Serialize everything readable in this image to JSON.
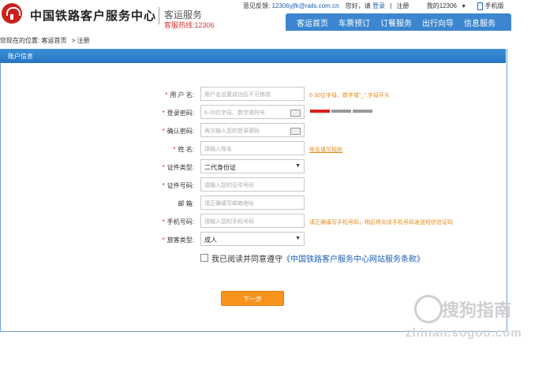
{
  "header": {
    "brand": "中国铁路客户服务中心",
    "brand_sub": "客运服务",
    "hotline": "客服热线:12306",
    "feedback_label": "意见反馈:",
    "feedback_email": "12306yjfk@rails.com.cn",
    "greeting": "您好，请",
    "login": "登录",
    "sep": "|",
    "register": "注册",
    "my12306": "我的12306",
    "mobile": "手机版"
  },
  "nav": [
    "客运首页",
    "车票预订",
    "订餐服务",
    "出行向导",
    "信息服务"
  ],
  "breadcrumb": {
    "prefix": "您现在的位置:",
    "home": "客运首页",
    "current": "> 注册"
  },
  "panel": {
    "title": "账户信息"
  },
  "form": {
    "username": {
      "label": "用 户 名:",
      "required": true,
      "placeholder": "用户名设置成功后不可修改",
      "hint": "6-30位字母、数字或\"_\",字母开头"
    },
    "password": {
      "label": "登录密码:",
      "required": true,
      "placeholder": "6-20位字母、数字或符号"
    },
    "confirm_password": {
      "label": "确认密码:",
      "required": true,
      "placeholder": "再次输入您的登录密码"
    },
    "name": {
      "label": "姓  名:",
      "required": true,
      "placeholder": "请输入姓名",
      "hint": "姓名填写规则"
    },
    "id_type": {
      "label": "证件类型:",
      "required": true,
      "value": "二代身份证"
    },
    "id_number": {
      "label": "证件号码:",
      "required": true,
      "placeholder": "请输入您的证件号码"
    },
    "email": {
      "label": "邮  箱:",
      "required": false,
      "placeholder": "请正确填写邮箱地址"
    },
    "phone": {
      "label": "手机号码:",
      "required": true,
      "placeholder": "请输入您的手机号码",
      "hint": "请正确填写手机号码，稍后将向该手机号码发送短信验证码"
    },
    "passenger_type": {
      "label": "旅客类型:",
      "required": true,
      "value": "成人"
    },
    "agree_text": "我已阅读并同意遵守",
    "agree_link": "《中国铁路客户服务中心网站服务条款》",
    "next_button": "下一步"
  },
  "watermark": {
    "text": "搜狗指南",
    "url": "zhinan.sogou.com"
  },
  "colors": {
    "nav_blue": "#3b86cf",
    "required_red": "#e02020",
    "hint_orange": "#e48a1a",
    "button_orange": "#f7931d",
    "strength_red": "#d81e1e",
    "strength_gray": "#999999"
  }
}
